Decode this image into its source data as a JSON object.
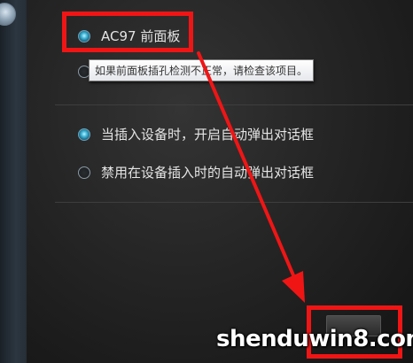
{
  "options": {
    "ac97_label": "AC97 前面板",
    "autopopup_enable_label": "当插入设备时，开启自动弹出对话框",
    "autopopup_disable_label": "禁用在设备插入时的自动弹出对话框"
  },
  "tooltip": {
    "text": "如果前面板插孔检测不正常，请检查该项目。"
  },
  "watermark": {
    "text": "shenduwin8.com"
  },
  "colors": {
    "annotation_red": "#f01515",
    "radio_selected": "#3eb4d6"
  },
  "icons": {
    "radio_selected": "radio-selected-icon",
    "radio_unselected": "radio-unselected-icon",
    "annotation_arrow": "arrow-icon"
  }
}
